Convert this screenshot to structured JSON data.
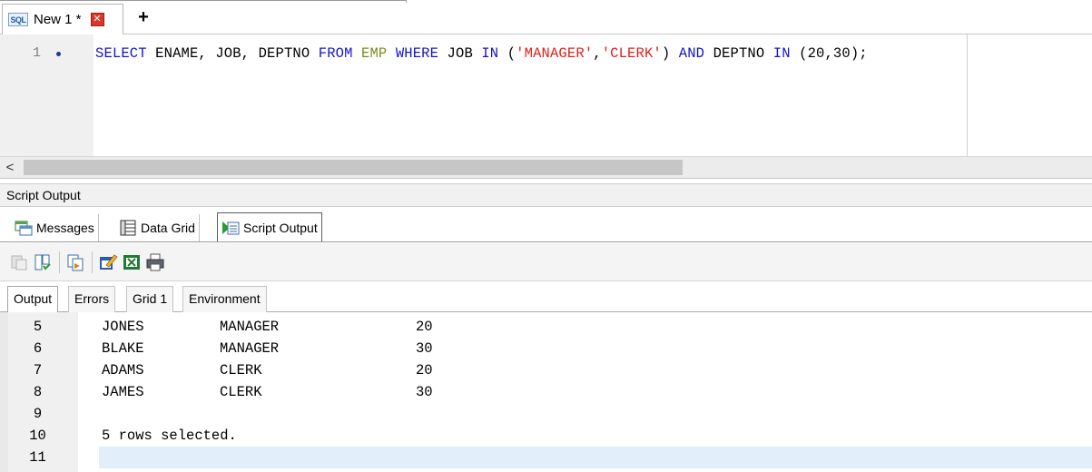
{
  "editor_tab": {
    "icon": "SQL",
    "title": "New 1 *",
    "add_label": "+"
  },
  "editor": {
    "line_number": "1",
    "sql": [
      {
        "t": "SELECT",
        "c": "kw"
      },
      {
        "t": " ENAME, JOB, DEPTNO ",
        "c": "pl"
      },
      {
        "t": "FROM",
        "c": "kw"
      },
      {
        "t": " ",
        "c": "pl"
      },
      {
        "t": "EMP",
        "c": "tb"
      },
      {
        "t": " ",
        "c": "pl"
      },
      {
        "t": "WHERE",
        "c": "kw"
      },
      {
        "t": " JOB ",
        "c": "pl"
      },
      {
        "t": "IN",
        "c": "kw"
      },
      {
        "t": " (",
        "c": "pl"
      },
      {
        "t": "'MANAGER'",
        "c": "st"
      },
      {
        "t": ",",
        "c": "pl"
      },
      {
        "t": "'CLERK'",
        "c": "st"
      },
      {
        "t": ") ",
        "c": "pl"
      },
      {
        "t": "AND",
        "c": "kw"
      },
      {
        "t": " DEPTNO ",
        "c": "pl"
      },
      {
        "t": "IN",
        "c": "kw"
      },
      {
        "t": " (20,30);",
        "c": "pl"
      }
    ]
  },
  "panel_title": "Script Output",
  "result_tabs": {
    "messages": "Messages",
    "data_grid": "Data Grid",
    "script_output": "Script Output"
  },
  "sub_tabs": {
    "output": "Output",
    "errors": "Errors",
    "grid": "Grid 1",
    "environment": "Environment"
  },
  "output_rows": [
    {
      "num": "5",
      "c1": "JONES",
      "c2": "MANAGER",
      "c3": "20"
    },
    {
      "num": "6",
      "c1": "BLAKE",
      "c2": "MANAGER",
      "c3": "30"
    },
    {
      "num": "7",
      "c1": "ADAMS",
      "c2": "CLERK",
      "c3": "20"
    },
    {
      "num": "8",
      "c1": "JAMES",
      "c2": "CLERK",
      "c3": "30"
    },
    {
      "num": "9",
      "c1": "",
      "c2": "",
      "c3": ""
    },
    {
      "num": "10",
      "c1": "5 rows selected.",
      "c2": "",
      "c3": ""
    },
    {
      "num": "11",
      "c1": "",
      "c2": "",
      "c3": ""
    }
  ],
  "colors": {
    "keyword": "#1414c8",
    "table": "#7a8c1c",
    "string": "#e0201a",
    "current_line": "#e3eefb"
  }
}
